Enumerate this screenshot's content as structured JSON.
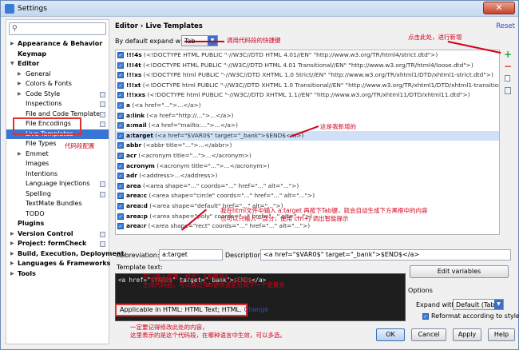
{
  "window": {
    "title": "Settings",
    "close_glyph": "✕"
  },
  "search": {
    "placeholder": ""
  },
  "tree": [
    {
      "label": "Appearance & Behavior",
      "bold": true,
      "arrow": "▶",
      "indent": 0
    },
    {
      "label": "Keymap",
      "bold": true,
      "arrow": "",
      "indent": 0
    },
    {
      "label": "Editor",
      "bold": true,
      "arrow": "▼",
      "indent": 0
    },
    {
      "label": "General",
      "bold": false,
      "arrow": "▶",
      "indent": 1
    },
    {
      "label": "Colors & Fonts",
      "bold": false,
      "arrow": "▶",
      "indent": 1
    },
    {
      "label": "Code Style",
      "bold": false,
      "arrow": "▶",
      "indent": 1,
      "proj": true
    },
    {
      "label": "Inspections",
      "bold": false,
      "arrow": "",
      "indent": 1,
      "proj": true
    },
    {
      "label": "File and Code Templates",
      "bold": false,
      "arrow": "",
      "indent": 1,
      "proj": true
    },
    {
      "label": "File Encodings",
      "bold": false,
      "arrow": "",
      "indent": 1,
      "proj": true
    },
    {
      "label": "Live Templates",
      "bold": false,
      "arrow": "",
      "indent": 1,
      "selected": true
    },
    {
      "label": "File Types",
      "bold": false,
      "arrow": "",
      "indent": 1
    },
    {
      "label": "Emmet",
      "bold": false,
      "arrow": "▶",
      "indent": 1
    },
    {
      "label": "Images",
      "bold": false,
      "arrow": "",
      "indent": 1
    },
    {
      "label": "Intentions",
      "bold": false,
      "arrow": "",
      "indent": 1
    },
    {
      "label": "Language Injections",
      "bold": false,
      "arrow": "",
      "indent": 1,
      "proj": true
    },
    {
      "label": "Spelling",
      "bold": false,
      "arrow": "",
      "indent": 1,
      "proj": true
    },
    {
      "label": "TextMate Bundles",
      "bold": false,
      "arrow": "",
      "indent": 1
    },
    {
      "label": "TODO",
      "bold": false,
      "arrow": "",
      "indent": 1
    },
    {
      "label": "Plugins",
      "bold": true,
      "arrow": "",
      "indent": 0
    },
    {
      "label": "Version Control",
      "bold": true,
      "arrow": "▶",
      "indent": 0,
      "proj": true
    },
    {
      "label": "Project: formCheck",
      "bold": true,
      "arrow": "▶",
      "indent": 0,
      "proj": true
    },
    {
      "label": "Build, Execution, Deployment",
      "bold": true,
      "arrow": "▶",
      "indent": 0
    },
    {
      "label": "Languages & Frameworks",
      "bold": true,
      "arrow": "▶",
      "indent": 0
    },
    {
      "label": "Tools",
      "bold": true,
      "arrow": "▶",
      "indent": 0
    }
  ],
  "header": {
    "breadcrumb": "Editor › Live Templates",
    "reset": "Reset"
  },
  "expand": {
    "label": "By default expand with",
    "value": "Tab",
    "dropdown_glyph": "▼"
  },
  "templates": [
    {
      "abbr": "!!!4s",
      "desc": " (<!DOCTYPE HTML PUBLIC \"-//W3C//DTD HTML 4.01//EN\" \"http://www.w3.org/TR/html4/strict.dtd\">)"
    },
    {
      "abbr": "!!!4t",
      "desc": " (<!DOCTYPE HTML PUBLIC \"-//W3C//DTD HTML 4.01 Transitional//EN\" \"http://www.w3.org/TR/html4/loose.dtd\">)"
    },
    {
      "abbr": "!!!xs",
      "desc": " (<!DOCTYPE html PUBLIC \"-//W3C//DTD XHTML 1.0 Strict//EN\" \"http://www.w3.org/TR/xhtml1/DTD/xhtml1-strict.dtd\">)"
    },
    {
      "abbr": "!!!xt",
      "desc": " (<!DOCTYPE html PUBLIC \"-//W3C//DTD XHTML 1.0 Transitional//EN\" \"http://www.w3.org/TR/xhtml1/DTD/xhtml1-transitional.dtd"
    },
    {
      "abbr": "!!!xxs",
      "desc": " (<!DOCTYPE html PUBLIC \"-//W3C//DTD XHTML 1.1//EN\" \"http://www.w3.org/TR/xhtml11/DTD/xhtml11.dtd\">)"
    },
    {
      "abbr": "a",
      "desc": " (<a href=\"...\">...</a>)"
    },
    {
      "abbr": "a:link",
      "desc": " (<a href=\"http://...\">...</a>)"
    },
    {
      "abbr": "a:mail",
      "desc": " (<a href=\"mailto:...\">...</a>)"
    },
    {
      "abbr": "a:target",
      "desc": " (<a href=\"$VAR0$\" target=\"_bank\">$END$</a>)",
      "selected": true
    },
    {
      "abbr": "abbr",
      "desc": " (<abbr title=\"...\">...</abbr>)"
    },
    {
      "abbr": "acr",
      "desc": " (<acronym title=\"...\">...</acronym>)"
    },
    {
      "abbr": "acronym",
      "desc": " (<acronym title=\"...\">...</acronym>)"
    },
    {
      "abbr": "adr",
      "desc": " (<address>...</address>)"
    },
    {
      "abbr": "area",
      "desc": " (<area shape=\"...\" coords=\"...\" href=\"...\" alt=\"...\">)"
    },
    {
      "abbr": "area:c",
      "desc": " (<area shape=\"circle\" coords=\"...\" href=\"...\" alt=\"...\">)"
    },
    {
      "abbr": "area:d",
      "desc": " (<area shape=\"default\" href=\"...\" alt=\"...\">)"
    },
    {
      "abbr": "area:p",
      "desc": " (<area shape=\"poly\" coords=\"...\" href=\"...\" alt=\"...\">)"
    },
    {
      "abbr": "area:r",
      "desc": " (<area shape=\"rect\" coords=\"...\" href=\"...\" alt=\"...\">)"
    }
  ],
  "tools": {
    "add": "+",
    "remove": "−",
    "copy": "",
    "group": ""
  },
  "editor": {
    "abbreviation_label": "Abbreviation:",
    "abbreviation_value": "a:target",
    "description_label": "Description:",
    "description_value": "<a href=\"$VAR0$\" target=\"_bank\">$END$</a>",
    "template_text_label": "Template text:",
    "code_prefix": "<a href=\"",
    "code_var": "$VAR0$",
    "code_middle": "\" target=\"_bank\">",
    "code_end": "$END$",
    "code_suffix": "</a>",
    "applicable": "Applicable in HTML: HTML Text; HTML.",
    "change": "Change",
    "edit_variables": "Edit variables",
    "options_label": "Options",
    "expand_with_label": "Expand with",
    "expand_with_value": "Default (Tab)",
    "reformat_label": "Reformat according to style"
  },
  "buttons": {
    "ok": "OK",
    "cancel": "Cancel",
    "apply": "Apply",
    "help": "Help"
  },
  "annotations": {
    "shortcut": "调用代码段的快捷键",
    "add_new": "点击此处，进行新增",
    "new_added": "这是我新增的",
    "snippet_config": "代码段配置",
    "usage_1": "我在html文件中输入  a:target 再按下Tab键，就会自动生成下方黑框中的内容",
    "usage_2": "也可以只输入一部分，使用 ctrl+J 调出智能提示",
    "var_1": "可以输入变量，格式：$变量名$",
    "var_2": "生成代码后，可以通过Tab键快速定位到下一个变量处",
    "scope_1": "一定要记得修改此处的内容，",
    "scope_2": "这里表示的是这个代码段，在哪种语言中生效，可以多选。"
  },
  "colors": {
    "accent": "#3875d7",
    "annotation": "#d0021b",
    "editor_bg": "#1e1e1e"
  }
}
